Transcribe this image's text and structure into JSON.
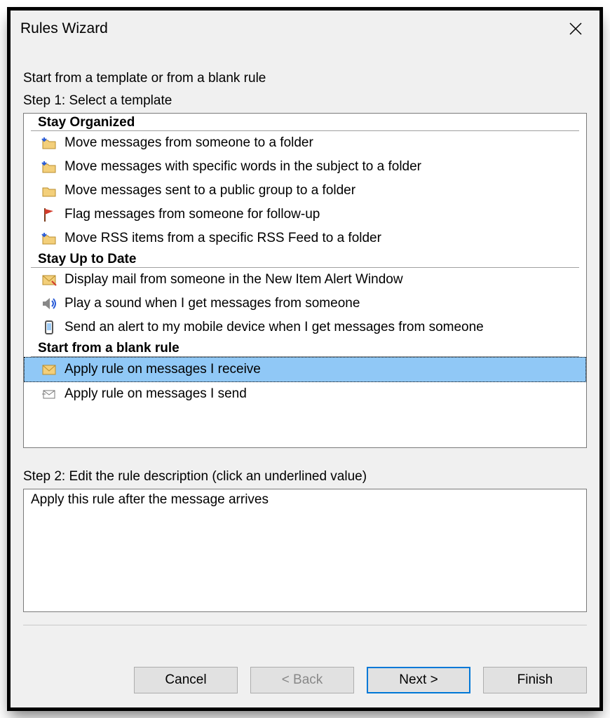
{
  "window": {
    "title": "Rules Wizard"
  },
  "intro": "Start from a template or from a blank rule",
  "step1_label": "Step 1: Select a template",
  "groups": {
    "g0": {
      "header": "Stay Organized"
    },
    "g1": {
      "header": "Stay Up to Date"
    },
    "g2": {
      "header": "Start from a blank rule"
    }
  },
  "templates": {
    "t0": "Move messages from someone to a folder",
    "t1": "Move messages with specific words in the subject to a folder",
    "t2": "Move messages sent to a public group to a folder",
    "t3": "Flag messages from someone for follow-up",
    "t4": "Move RSS items from a specific RSS Feed to a folder",
    "t5": "Display mail from someone in the New Item Alert Window",
    "t6": "Play a sound when I get messages from someone",
    "t7": "Send an alert to my mobile device when I get messages from someone",
    "t8": "Apply rule on messages I receive",
    "t9": "Apply rule on messages I send"
  },
  "step2_label": "Step 2: Edit the rule description (click an underlined value)",
  "description": "Apply this rule after the message arrives",
  "buttons": {
    "cancel": "Cancel",
    "back": "< Back",
    "next": "Next >",
    "finish": "Finish"
  }
}
